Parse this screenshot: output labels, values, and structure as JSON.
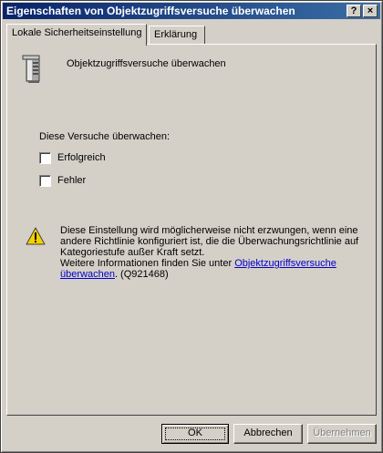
{
  "window": {
    "title": "Eigenschaften von Objektzugriffsversuche überwachen",
    "help_button": "?",
    "close_button": "×"
  },
  "tabs": [
    {
      "label": "Lokale Sicherheitseinstellung",
      "active": true
    },
    {
      "label": "Erklärung",
      "active": false
    }
  ],
  "policy": {
    "name": "Objektzugriffsversuche überwachen",
    "icon": "server-icon"
  },
  "audit": {
    "group_label": "Diese Versuche überwachen:",
    "options": [
      {
        "label": "Erfolgreich",
        "checked": false
      },
      {
        "label": "Fehler",
        "checked": false
      }
    ]
  },
  "warning": {
    "icon": "warning-icon",
    "text": "Diese Einstellung wird möglicherweise nicht erzwungen, wenn eine andere Richtlinie konfiguriert ist, die die Überwachungsrichtlinie auf Kategoriestufe außer Kraft setzt.",
    "more_info_prefix": "Weitere Informationen finden Sie unter ",
    "link_text": "Objektzugriffsversuche überwachen",
    "suffix": ". (Q921468)"
  },
  "buttons": {
    "ok": "OK",
    "cancel": "Abbrechen",
    "apply": "Übernehmen"
  },
  "colors": {
    "titlebar_start": "#0a246a",
    "titlebar_end": "#3a6ea5",
    "face": "#d4d0c8",
    "link": "#0000cc"
  }
}
